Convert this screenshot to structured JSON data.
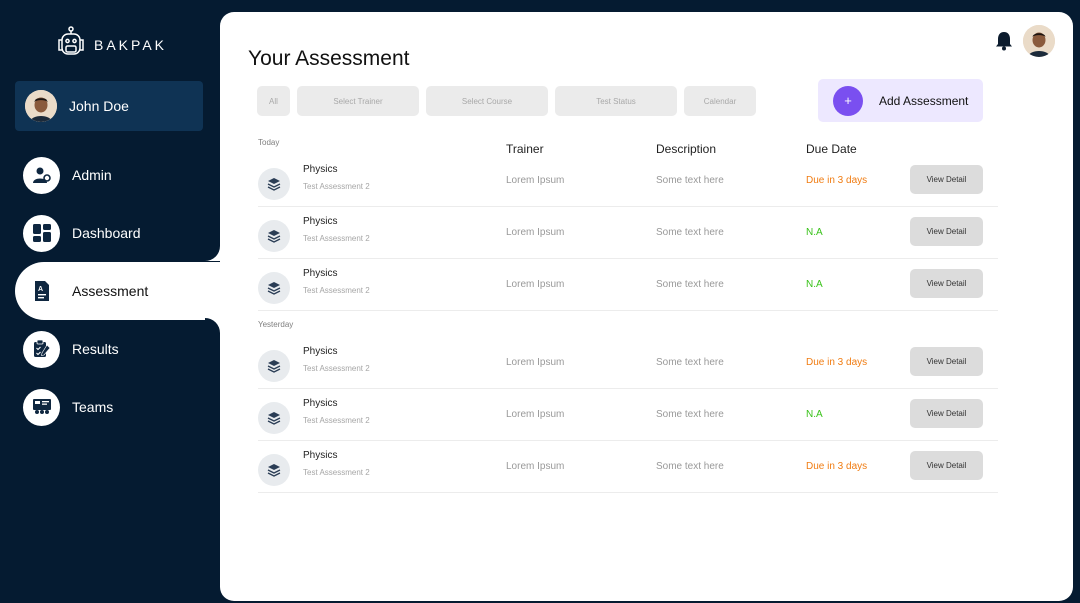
{
  "brand": {
    "name": "BAKPAK"
  },
  "user": {
    "name": "John Doe"
  },
  "nav": [
    {
      "label": "Admin",
      "icon": "admin-icon"
    },
    {
      "label": "Dashboard",
      "icon": "dashboard-icon"
    },
    {
      "label": "Assessment",
      "icon": "assessment-icon",
      "active": true
    },
    {
      "label": "Results",
      "icon": "results-icon"
    },
    {
      "label": "Teams",
      "icon": "teams-icon"
    }
  ],
  "page": {
    "title": "Your Assessment"
  },
  "filters": [
    "All",
    "Select Trainer",
    "Select Course",
    "Test Status",
    "Calendar"
  ],
  "add_button": {
    "label": "Add Assessment",
    "icon": "+"
  },
  "columns": {
    "trainer": "Trainer",
    "description": "Description",
    "due_date": "Due Date"
  },
  "sections": [
    {
      "label": "Today",
      "rows": [
        {
          "subject": "Physics",
          "subtitle": "Test Assessment 2",
          "trainer": "Lorem Ipsum",
          "description": "Some text here",
          "due": "Due in 3 days",
          "action": "View Detail"
        },
        {
          "subject": "Physics",
          "subtitle": "Test Assessment 2",
          "trainer": "Lorem Ipsum",
          "description": "Some text here",
          "due": "N.A",
          "action": "View Detail"
        },
        {
          "subject": "Physics",
          "subtitle": "Test Assessment 2",
          "trainer": "Lorem Ipsum",
          "description": "Some text here",
          "due": "N.A",
          "action": "View Detail"
        }
      ]
    },
    {
      "label": "Yesterday",
      "rows": [
        {
          "subject": "Physics",
          "subtitle": "Test Assessment 2",
          "trainer": "Lorem Ipsum",
          "description": "Some text here",
          "due": "Due in 3 days",
          "action": "View Detail"
        },
        {
          "subject": "Physics",
          "subtitle": "Test Assessment 2",
          "trainer": "Lorem Ipsum",
          "description": "Some text here",
          "due": "N.A",
          "action": "View Detail"
        },
        {
          "subject": "Physics",
          "subtitle": "Test Assessment 2",
          "trainer": "Lorem Ipsum",
          "description": "Some text here",
          "due": "Due in 3 days",
          "action": "View Detail"
        }
      ]
    }
  ],
  "colors": {
    "sidebar": "#051b31",
    "user_card": "#0f3354",
    "accent": "#7a4ff0",
    "due_soon": "#f07c12",
    "na": "#39c21a"
  }
}
